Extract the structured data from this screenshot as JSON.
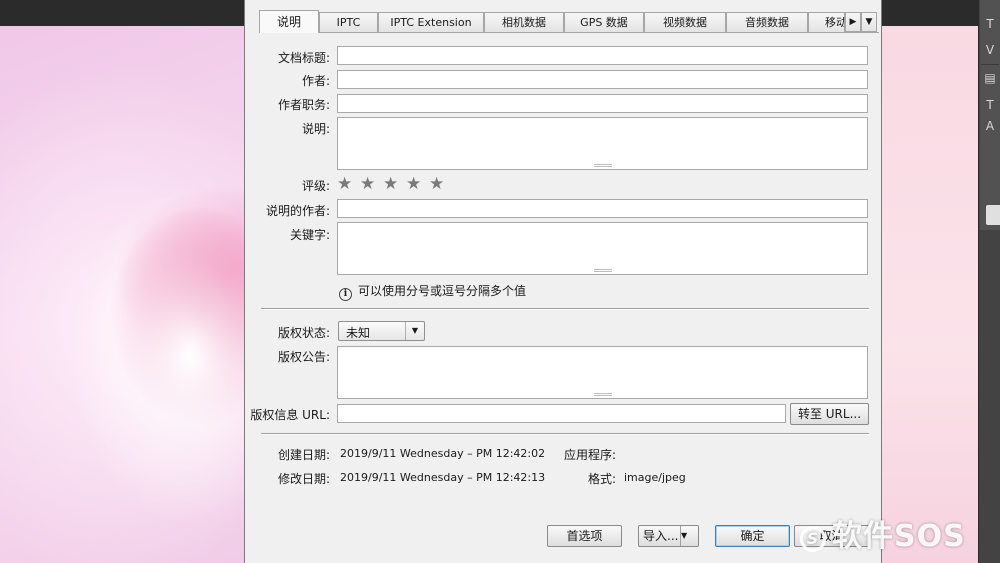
{
  "tabs": [
    "说明",
    "IPTC",
    "IPTC Extension",
    "相机数据",
    "GPS 数据",
    "视频数据",
    "音频数据",
    "移动"
  ],
  "tab_scroll_icon": "play-right-icon",
  "tab_menu_icon": "dropdown-arrow-icon",
  "fields": {
    "doc_title_label": "文档标题:",
    "author_label": "作者:",
    "author_title_label": "作者职务:",
    "description_label": "说明:",
    "rating_label": "评级:",
    "rating_value": 0,
    "rating_max": 5,
    "description_writer_label": "说明的作者:",
    "keywords_label": "关键字:",
    "keywords_hint": "可以使用分号或逗号分隔多个值",
    "copyright_status_label": "版权状态:",
    "copyright_status_value": "未知",
    "copyright_notice_label": "版权公告:",
    "copyright_url_label": "版权信息 URL:",
    "goto_url_button": "转至 URL..."
  },
  "metadata": {
    "created_label": "创建日期:",
    "created_value": "2019/9/11 Wednesday – PM 12:42:02",
    "modified_label": "修改日期:",
    "modified_value": "2019/9/11 Wednesday – PM 12:42:13",
    "application_label": "应用程序:",
    "application_value": "",
    "format_label": "格式:",
    "format_value": "image/jpeg"
  },
  "buttons": {
    "preferences": "首选项",
    "import": "导入...",
    "ok": "确定",
    "cancel": "取消"
  },
  "watermark": "软件SOS",
  "colors": {
    "dialog_bg": "#f0f0f0",
    "star_color": "#7a7a7a",
    "default_button_border": "#3c7fb1"
  }
}
